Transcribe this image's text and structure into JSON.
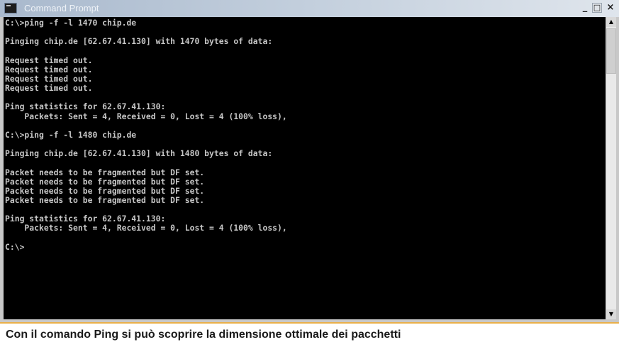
{
  "window": {
    "title": "Command Prompt",
    "minimize": "_",
    "maximize": "□",
    "close": "×"
  },
  "console": {
    "lines": [
      "C:\\>ping -f -l 1470 chip.de",
      "",
      "Pinging chip.de [62.67.41.130] with 1470 bytes of data:",
      "",
      "Request timed out.",
      "Request timed out.",
      "Request timed out.",
      "Request timed out.",
      "",
      "Ping statistics for 62.67.41.130:",
      "    Packets: Sent = 4, Received = 0, Lost = 4 (100% loss),",
      "",
      "C:\\>ping -f -l 1480 chip.de",
      "",
      "Pinging chip.de [62.67.41.130] with 1480 bytes of data:",
      "",
      "Packet needs to be fragmented but DF set.",
      "Packet needs to be fragmented but DF set.",
      "Packet needs to be fragmented but DF set.",
      "Packet needs to be fragmented but DF set.",
      "",
      "Ping statistics for 62.67.41.130:",
      "    Packets: Sent = 4, Received = 0, Lost = 4 (100% loss),",
      "",
      "C:\\>"
    ]
  },
  "scrollbar": {
    "up": "▲",
    "down": "▼"
  },
  "caption": "Con il comando Ping si può scoprire la dimensione ottimale dei pacchetti"
}
